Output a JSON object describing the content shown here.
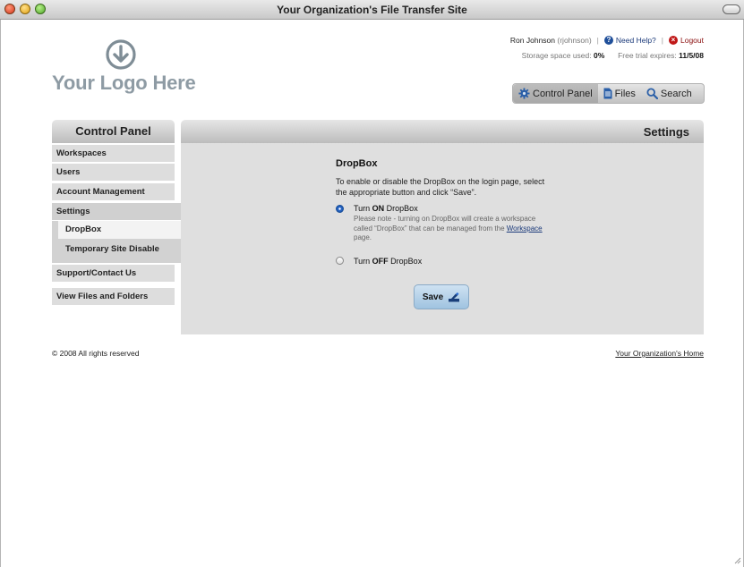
{
  "window": {
    "title": "Your Organization's File Transfer Site"
  },
  "logo": {
    "text": "Your Logo Here"
  },
  "user": {
    "name": "Ron Johnson",
    "username": "(rjohnson)",
    "help": "Need Help?",
    "logout": "Logout",
    "storage_label": "Storage space used:",
    "storage_value": "0%",
    "trial_label": "Free trial expires:",
    "trial_value": "11/5/08"
  },
  "topnav": {
    "items": [
      {
        "label": "Control Panel",
        "icon": "gear-icon"
      },
      {
        "label": "Files",
        "icon": "document-icon"
      },
      {
        "label": "Search",
        "icon": "search-icon"
      }
    ]
  },
  "sidebar": {
    "title": "Control Panel",
    "items": [
      {
        "label": "Workspaces"
      },
      {
        "label": "Users"
      },
      {
        "label": "Account Management"
      },
      {
        "label": "Settings"
      },
      {
        "label": "Support/Contact Us"
      },
      {
        "label": "View Files and Folders"
      }
    ],
    "subitems": [
      {
        "label": "DropBox"
      },
      {
        "label": "Temporary Site Disable"
      }
    ]
  },
  "main": {
    "title": "Settings",
    "section_title": "DropBox",
    "description": "To enable or disable the DropBox on the login page, select the appropriate button and click “Save”.",
    "option_on": {
      "pre": "Turn ",
      "bold": "ON",
      "post": " DropBox",
      "selected": true
    },
    "note_pre": "Please note - turning on DropBox will create a workspace called “DropBox” that can be managed from the ",
    "note_link": "Workspace",
    "note_post": " page.",
    "option_off": {
      "pre": "Turn ",
      "bold": "OFF",
      "post": " DropBox",
      "selected": false
    },
    "save_label": "Save"
  },
  "footer": {
    "copyright": "© 2008 All rights reserved",
    "home_link": "Your Organization's Home"
  },
  "colors": {
    "accent": "#1b3a7a",
    "logo": "#8e9ba4",
    "panel": "#dfdfdf"
  }
}
